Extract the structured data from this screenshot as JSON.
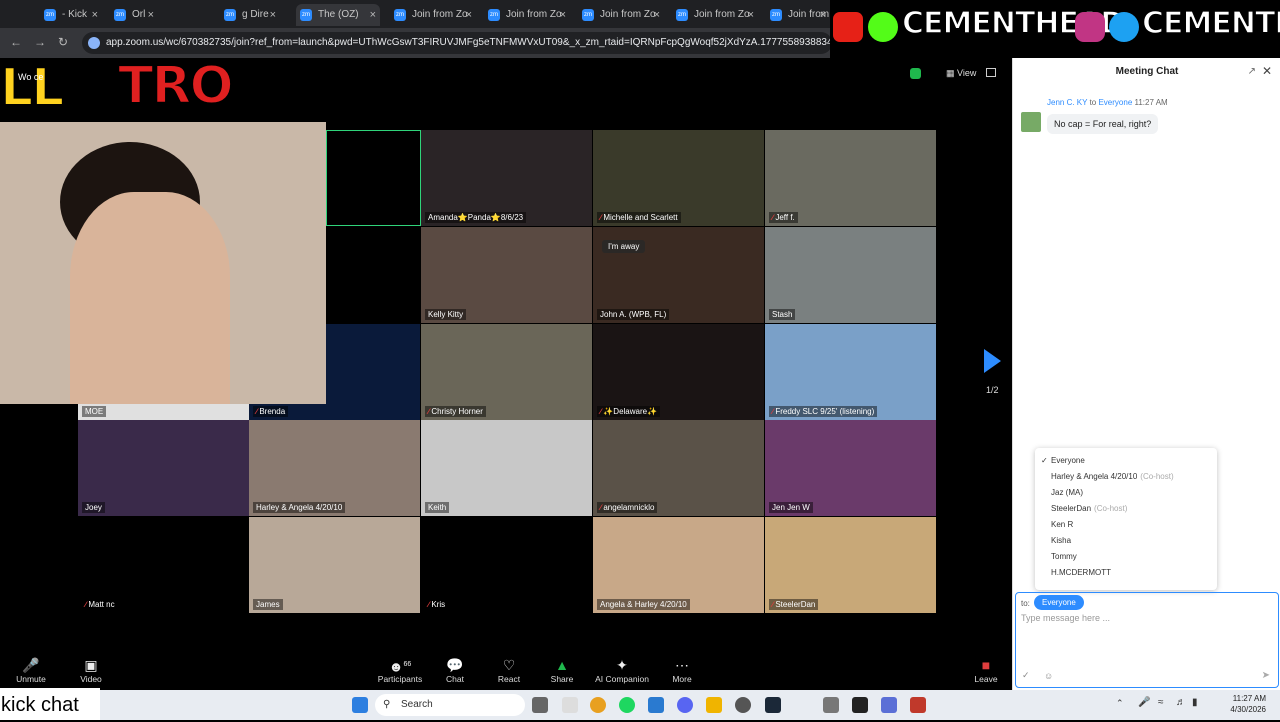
{
  "browser": {
    "tabs": [
      {
        "label": "- Kick"
      },
      {
        "label": "Orl"
      },
      {
        "label": "g Dire"
      },
      {
        "label": "The (OZ)"
      },
      {
        "label": "Join from Zo"
      },
      {
        "label": "Join from Zo"
      },
      {
        "label": "Join from Zo"
      },
      {
        "label": "Join from Zo"
      },
      {
        "label": "Join from Ze"
      }
    ],
    "url": "app.zoom.us/wc/670382735/join?ref_from=launch&pwd=UThWcGswT3FIRUVJMFg5eTNFMWVxUT09&_x_zm_rtaid=IQRNpFcpQgWoqf52jXdYzA.1777558938834.bf507dee6f67"
  },
  "banner": {
    "handle_left": "CEMENTHEAD",
    "handle_right": "CEMENTIII"
  },
  "overlay": {
    "logo_left": "LL",
    "logo_right": "TRO",
    "small": "Wo   ce"
  },
  "meeting": {
    "view_label": "View",
    "page_indicator": "1/2",
    "away_badge": "I'm away",
    "tiles": [
      {
        "name": "Amanda⭐Panda⭐8/6/23",
        "muted": false,
        "star": true,
        "color": "#2a2426"
      },
      {
        "name": "Michelle and Scarlett",
        "muted": true,
        "color": "#3a3a2a"
      },
      {
        "name": "Jeff f.",
        "muted": true,
        "color": "#6a6a60"
      },
      {
        "name": "Kelly Kitty",
        "muted": false,
        "color": "#5a4a42"
      },
      {
        "name": "John A. (WPB, FL)",
        "muted": false,
        "color": "#3a2a22"
      },
      {
        "name": "Stash",
        "muted": false,
        "color": "#7a8080"
      },
      {
        "name": "MOE",
        "muted": false,
        "color": "#e0e0e0"
      },
      {
        "name": "Brenda",
        "muted": true,
        "color": "#0a1a3a"
      },
      {
        "name": "Christy Horner",
        "muted": true,
        "color": "#6a6658"
      },
      {
        "name": "✨Delaware✨",
        "muted": true,
        "color": "#1a1414"
      },
      {
        "name": "Freddy SLC 9/25' (listening)",
        "muted": true,
        "color": "#7aa0c8"
      },
      {
        "name": "Joey",
        "muted": false,
        "color": "#3a2a4a"
      },
      {
        "name": "Harley & Angela 4/20/10",
        "muted": false,
        "color": "#8a7a70"
      },
      {
        "name": "Keith",
        "muted": false,
        "color": "#c8c8c8"
      },
      {
        "name": "angelamnicklo",
        "muted": true,
        "color": "#5a5248"
      },
      {
        "name": "Jen Jen W",
        "muted": false,
        "color": "#6a3a6a"
      },
      {
        "name": "Matt nc",
        "muted": true,
        "color": "#000000"
      },
      {
        "name": "James",
        "muted": false,
        "color": "#b8a898"
      },
      {
        "name": "Kris",
        "muted": true,
        "color": "#000000"
      },
      {
        "name": "Angela & Harley 4/20/10",
        "muted": false,
        "color": "#c8a888"
      },
      {
        "name": "SteelerDan",
        "muted": true,
        "color": "#c8a878"
      }
    ]
  },
  "toolbar": {
    "unmute": "Unmute",
    "video": "Video",
    "participants": "Participants",
    "participants_count": "66",
    "chat": "Chat",
    "react": "React",
    "share": "Share",
    "ai": "AI Companion",
    "more": "More",
    "leave": "Leave"
  },
  "chat": {
    "title": "Meeting Chat",
    "sender": "Jenn C. KY",
    "to_word": "to",
    "recipient": "Everyone",
    "time": "11:27 AM",
    "message": "No cap = For real, right?",
    "dropdown": [
      {
        "label": "Everyone",
        "suffix": "",
        "checked": true
      },
      {
        "label": "Harley & Angela 4/20/10",
        "suffix": "(Co-host)",
        "checked": false
      },
      {
        "label": "Jaz (MA)",
        "suffix": "",
        "checked": false
      },
      {
        "label": "SteelerDan",
        "suffix": "(Co-host)",
        "checked": false
      },
      {
        "label": "Ken R",
        "suffix": "",
        "checked": false
      },
      {
        "label": "Kisha",
        "suffix": "",
        "checked": false
      },
      {
        "label": "Tommy",
        "suffix": "",
        "checked": false
      },
      {
        "label": "H.MCDERMOTT",
        "suffix": "",
        "checked": false
      }
    ],
    "to_label": "to:",
    "to_value": "Everyone",
    "placeholder": "Type message here ..."
  },
  "taskbar": {
    "overlay_text": "kick chat",
    "search": "Search",
    "time": "11:27 AM",
    "date": "4/30/2026"
  }
}
